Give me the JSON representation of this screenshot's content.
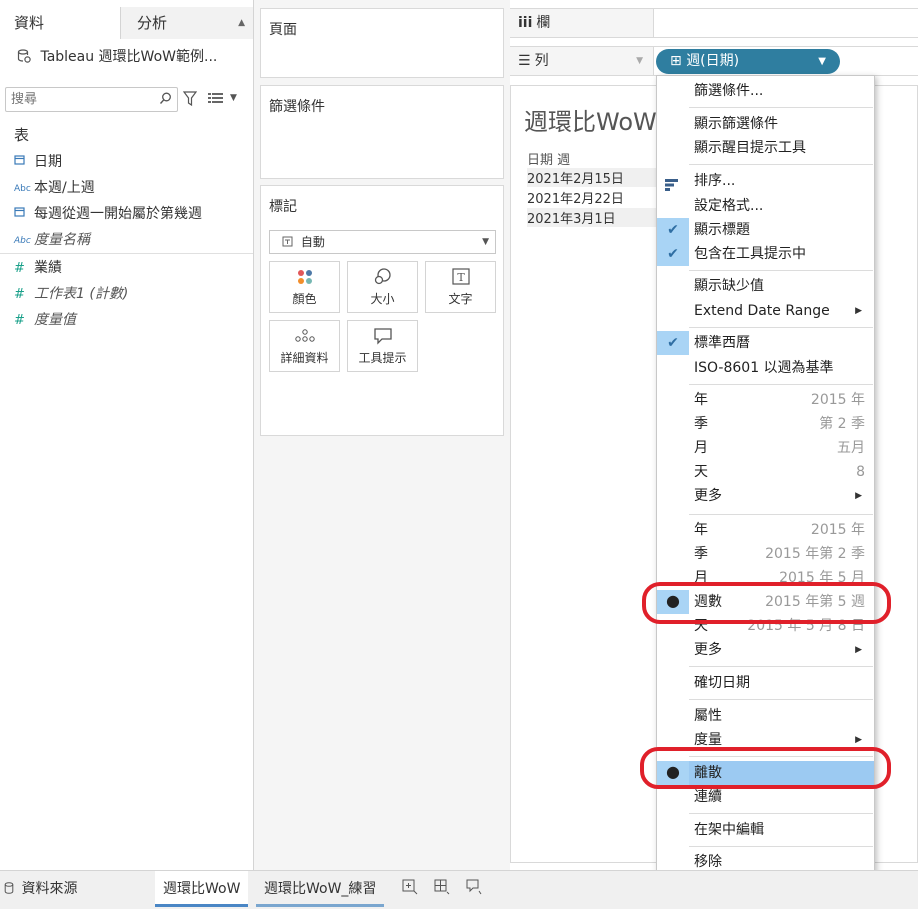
{
  "left_pane": {
    "tabs": [
      "資料",
      "分析"
    ],
    "datasource": "Tableau 週環比WoW範例...",
    "search_placeholder": "搜尋",
    "section_title": "表",
    "dimensions": [
      {
        "type": "date",
        "icon_text": "",
        "label": "日期",
        "italic": false
      },
      {
        "type": "string",
        "icon_text": "Abc",
        "label": "本週/上週",
        "italic": false
      },
      {
        "type": "date",
        "icon_text": "",
        "label": "每週從週一開始屬於第幾週",
        "italic": false
      },
      {
        "type": "string",
        "icon_text": "Abc",
        "label": "度量名稱",
        "italic": true
      }
    ],
    "measures": [
      {
        "type": "measure",
        "icon_text": "#",
        "label": "業績",
        "italic": false
      },
      {
        "type": "measure",
        "icon_text": "#",
        "label": "工作表1 (計數)",
        "italic": true
      },
      {
        "type": "measure",
        "icon_text": "#",
        "label": "度量值",
        "italic": true
      }
    ]
  },
  "shelves": {
    "pages_label": "頁面",
    "filters_label": "篩選條件",
    "marks_label": "標記",
    "marks_type": "自動",
    "mark_buttons": [
      "顏色",
      "大小",
      "文字",
      "詳細資料",
      "工具提示"
    ]
  },
  "canvas": {
    "columns_label": "欄",
    "rows_label": "列",
    "pill_label": "週(日期)",
    "viz_title": "週環比WoW",
    "header": "日期 週",
    "rows": [
      "2021年2月15日",
      "2021年2月22日",
      "2021年3月1日"
    ]
  },
  "context_menu": {
    "items": [
      {
        "label": "篩選條件...",
        "value": "",
        "state": "none"
      },
      {
        "label": "顯示篩選條件",
        "value": "",
        "state": "none"
      },
      {
        "label": "顯示醒目提示工具",
        "value": "",
        "state": "none"
      },
      {
        "label": "排序...",
        "value": "",
        "state": "icon"
      },
      {
        "label": "設定格式...",
        "value": "",
        "state": "none"
      },
      {
        "label": "顯示標題",
        "value": "",
        "state": "check"
      },
      {
        "label": "包含在工具提示中",
        "value": "",
        "state": "check"
      },
      {
        "label": "顯示缺少值",
        "value": "",
        "state": "none"
      },
      {
        "label": "Extend Date Range",
        "value": "",
        "state": "submenu"
      },
      {
        "label": "標準西曆",
        "value": "",
        "state": "check"
      },
      {
        "label": "ISO-8601 以週為基準",
        "value": "",
        "state": "none"
      },
      {
        "label": "年",
        "value": "2015 年",
        "state": "none"
      },
      {
        "label": "季",
        "value": "第 2 季",
        "state": "none"
      },
      {
        "label": "月",
        "value": "五月",
        "state": "none"
      },
      {
        "label": "天",
        "value": "8",
        "state": "none"
      },
      {
        "label": "更多",
        "value": "",
        "state": "submenu"
      },
      {
        "label": "年",
        "value": "2015 年",
        "state": "none"
      },
      {
        "label": "季",
        "value": "2015 年第 2 季",
        "state": "none"
      },
      {
        "label": "月",
        "value": "2015 年 5 月",
        "state": "none"
      },
      {
        "label": "週數",
        "value": "2015 年第 5 週",
        "state": "bullet"
      },
      {
        "label": "天",
        "value": "2015 年 5 月 8 日",
        "state": "none"
      },
      {
        "label": "更多",
        "value": "",
        "state": "submenu"
      },
      {
        "label": "確切日期",
        "value": "",
        "state": "none"
      },
      {
        "label": "屬性",
        "value": "",
        "state": "none"
      },
      {
        "label": "度量",
        "value": "",
        "state": "submenu"
      },
      {
        "label": "離散",
        "value": "",
        "state": "bullet-highlight"
      },
      {
        "label": "連續",
        "value": "",
        "state": "none"
      },
      {
        "label": "在架中編輯",
        "value": "",
        "state": "none"
      },
      {
        "label": "移除",
        "value": "",
        "state": "none"
      }
    ]
  },
  "bottom_tabs": {
    "datasource_tab": "資料來源",
    "sheets": [
      "週環比WoW",
      "週環比WoW_練習"
    ]
  },
  "colors": {
    "pill": "#2f7ea0",
    "menu_highlight": "#9ccaf2",
    "check_bg": "#a9d4f5",
    "annotation": "#e0202a",
    "dimension_icon": "#3a7ab8",
    "measure_icon": "#1aa08a"
  }
}
